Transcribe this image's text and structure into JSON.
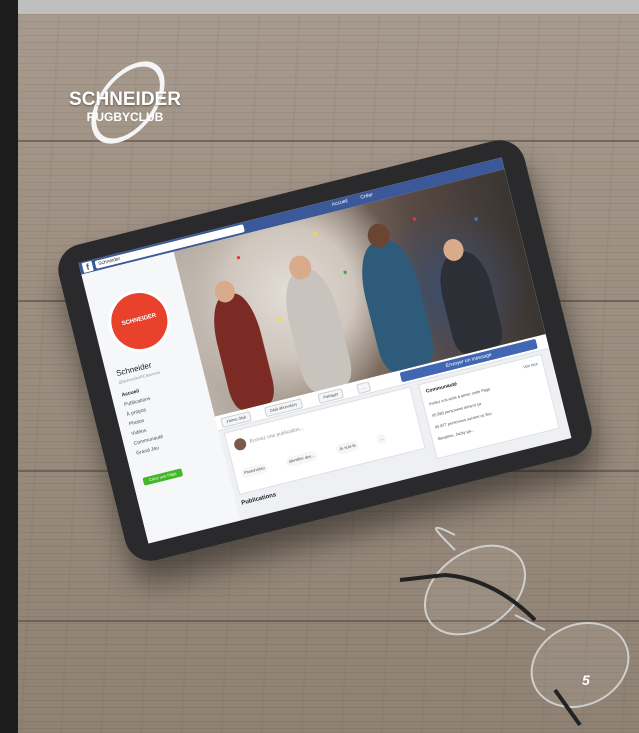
{
  "brand": {
    "logo_line1": "SCHNEIDER",
    "logo_line2": "RUGBYCLUB"
  },
  "page_number": "5",
  "facebook": {
    "search_text": "Schneider",
    "nav_items": [
      "Accueil",
      "Créer"
    ],
    "profile_badge": "SCHNEIDER",
    "page_name": "Schneider",
    "page_handle": "@SchneiderRCSaverne",
    "menu": [
      "Accueil",
      "Publications",
      "À propos",
      "Photos",
      "Vidéos",
      "Communauté",
      "Grand Jeu"
    ],
    "create_page_button": "Créer une Page",
    "action_buttons": [
      "J'aime déjà",
      "Déjà abonné(e)",
      "Partager",
      "..."
    ],
    "send_message_button": "Envoyer un message",
    "composer_placeholder": "Écrivez une publication...",
    "composer_chips": [
      "Photo/vidéo",
      "Identifier des...",
      "Je suis là",
      "..."
    ],
    "publications_heading": "Publications",
    "community": {
      "title": "Communauté",
      "see_all": "Voir tout",
      "rows": [
        "Invitez vos amis à aimer cette Page",
        "45 883 personnes aiment ça",
        "45 877 personnes suivent ce lieu",
        "Sandrine, Jacky ga..."
      ]
    },
    "colors": {
      "bar": "#3b5998",
      "avatar": "#e8412c",
      "cta": "#42b72a"
    }
  }
}
